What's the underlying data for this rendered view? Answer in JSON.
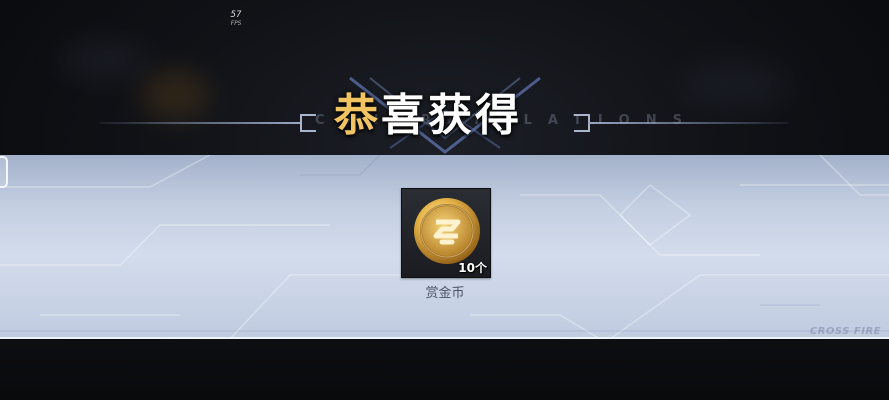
{
  "hud": {
    "fps_value": "57",
    "fps_unit": "FPS"
  },
  "reward_popup": {
    "title_first_char": "恭",
    "title_rest": "喜获得",
    "watermark_text": "CONGRATULATIONS",
    "brand_watermark": "CROSS FIRE",
    "items": [
      {
        "name": "赏金币",
        "quantity": "10个",
        "icon": "bounty-coin-icon"
      }
    ]
  },
  "colors": {
    "title_accent": "#f2c461",
    "banner": "#c4cfe2",
    "coin_gold": "#d9a43a"
  }
}
